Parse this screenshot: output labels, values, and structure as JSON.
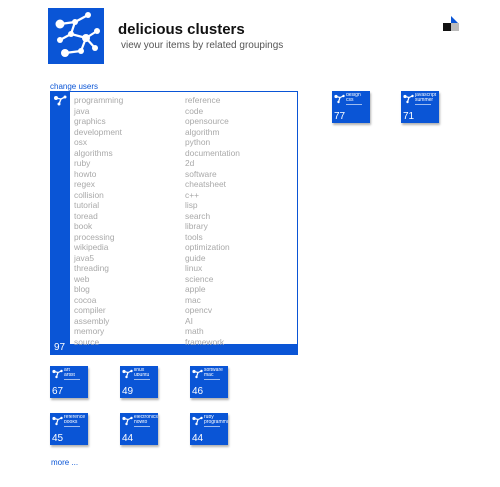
{
  "header": {
    "title": "delicious clusters",
    "subtitle": "view your items by related groupings",
    "logo_icon": "network-graph-icon",
    "corner_icon": "flag-icon"
  },
  "change_users_label": "change users",
  "main_cluster": {
    "count": "97",
    "tags_col1": [
      "programming",
      "java",
      "graphics",
      "development",
      "osx",
      "algorithms",
      "ruby",
      "howto",
      "regex",
      "collision",
      "tutorial",
      "toread",
      "book",
      "processing",
      "wikipedia",
      "java5",
      "threading",
      "web",
      "blog",
      "cocoa",
      "compiler",
      "assembly",
      "memory",
      "source"
    ],
    "tags_col2": [
      "reference",
      "code",
      "opensource",
      "algorithm",
      "python",
      "documentation",
      "2d",
      "software",
      "cheatsheet",
      "c++",
      "lisp",
      "search",
      "library",
      "tools",
      "optimization",
      "guide",
      "linux",
      "science",
      "apple",
      "mac",
      "opencv",
      "AI",
      "math",
      "framework"
    ]
  },
  "tiles": [
    {
      "count": "77",
      "line1": "design",
      "line2": "css"
    },
    {
      "count": "71",
      "line1": "javascript",
      "line2": "summer"
    },
    {
      "count": "67",
      "line1": "art",
      "line2": "artist"
    },
    {
      "count": "49",
      "line1": "linux",
      "line2": "ubuntu"
    },
    {
      "count": "46",
      "line1": "software",
      "line2": "mac"
    },
    {
      "count": "45",
      "line1": "reference",
      "line2": "books"
    },
    {
      "count": "44",
      "line1": "electronics",
      "line2": "howto"
    },
    {
      "count": "44",
      "line1": "ruby",
      "line2": "programming"
    }
  ],
  "more_label": "more ...",
  "colors": {
    "accent": "#0a55d6",
    "tag": "#a9a9a9"
  }
}
